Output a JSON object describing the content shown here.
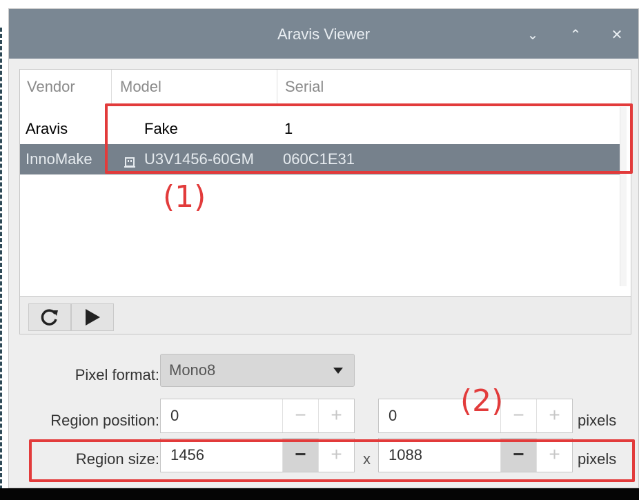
{
  "window": {
    "title": "Aravis Viewer",
    "buttons": {
      "minimize": "⌄",
      "maximize": "⌃",
      "close": "✕"
    }
  },
  "camera_list": {
    "columns": [
      "Vendor",
      "Model",
      "Serial"
    ],
    "rows": [
      {
        "vendor": "Aravis",
        "model": "Fake",
        "serial": "1",
        "selected": false
      },
      {
        "vendor": "InnoMake",
        "model": "U3V1456-60GM",
        "serial": "060C1E31",
        "selected": true,
        "icon": "usb-icon"
      }
    ]
  },
  "toolbar": {
    "refresh_icon": "refresh-icon",
    "play_icon": "play-icon"
  },
  "controls": {
    "pixel_format_label": "Pixel format:",
    "pixel_format_value": "Mono8",
    "region_position_label": "Region position:",
    "region_position_x": "0",
    "region_position_y": "0",
    "region_size_label": "Region size:",
    "region_size_w": "1456",
    "region_size_h": "1088",
    "unit": "pixels",
    "times": "x",
    "minus": "−",
    "plus": "+"
  },
  "annotations": {
    "one": "(1)",
    "two": "(2)"
  },
  "colors": {
    "titlebar": "#7a8793",
    "selection": "#76818c",
    "annotation": "#e23b3b"
  }
}
